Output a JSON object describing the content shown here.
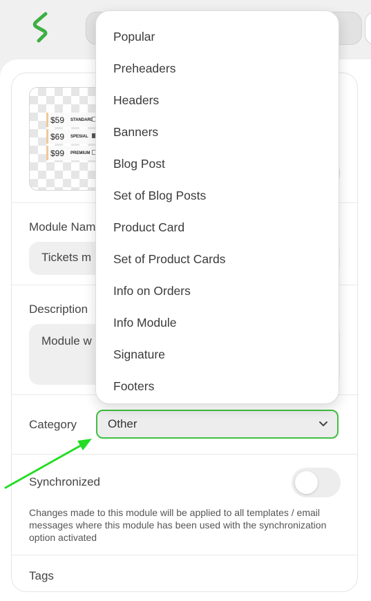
{
  "category_options": [
    "Popular",
    "Preheaders",
    "Headers",
    "Banners",
    "Blog Post",
    "Set of Blog Posts",
    "Product Card",
    "Set of Product Cards",
    "Info on Orders",
    "Info Module",
    "Signature",
    "Footers"
  ],
  "thumbnail": {
    "tickets": [
      {
        "price": "$59",
        "name": "STANDARD"
      },
      {
        "price": "$69",
        "name": "SPESIAL"
      },
      {
        "price": "$99",
        "name": "PREMIUM"
      }
    ]
  },
  "module_name": {
    "label": "Module Nam",
    "value": "Tickets m"
  },
  "description": {
    "label": "Description",
    "value": "Module w"
  },
  "category": {
    "label": "Category",
    "selected": "Other"
  },
  "synchronized": {
    "label": "Synchronized",
    "enabled": false,
    "description": "Changes made to this module will be applied to all templates / email messages where this module has been used with the synchronization option activated"
  },
  "tags": {
    "label": "Tags"
  },
  "colors": {
    "accent_green": "#3fbf3f",
    "arrow_green": "#22dd22",
    "logo_green": "#3cb043"
  },
  "icons": {
    "logo": "stripo-logo-icon",
    "select_chevron": "chevron-down-icon",
    "annotation": "green-arrow-icon"
  }
}
